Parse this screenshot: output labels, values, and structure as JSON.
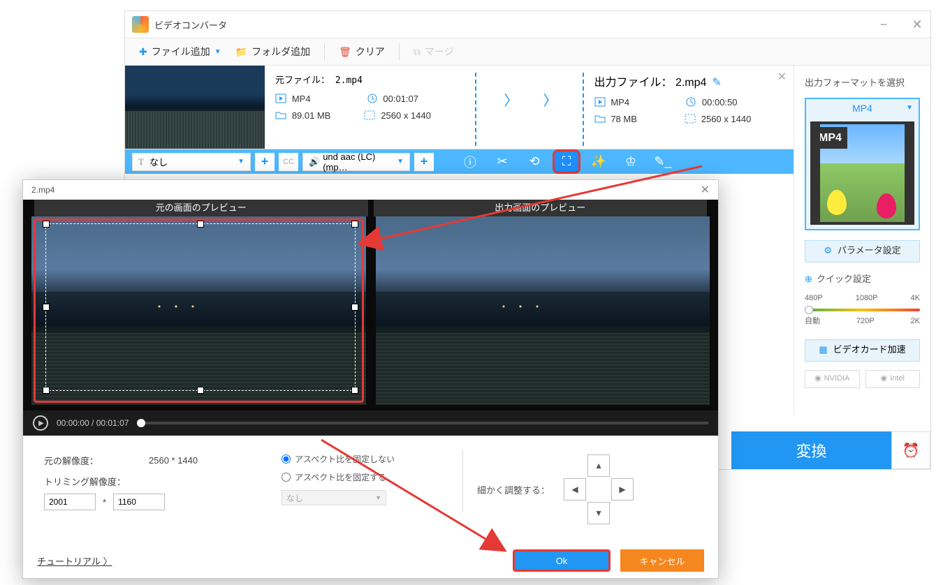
{
  "app": {
    "title": "ビデオコンバータ"
  },
  "toolbar": {
    "add_file": "ファイル追加",
    "add_folder": "フォルダ追加",
    "clear": "クリア",
    "merge": "マージ"
  },
  "file": {
    "source_label": "元ファイル： 2.mp4",
    "output_label": "出力ファイル： 2.mp4",
    "src": {
      "format": "MP4",
      "duration": "00:01:07",
      "size": "89.01 MB",
      "resolution": "2560 x 1440"
    },
    "out": {
      "format": "MP4",
      "duration": "00:00:50",
      "size": "78 MB",
      "resolution": "2560 x 1440"
    }
  },
  "strip": {
    "subtitle_select": "なし",
    "subtitle_prefix": "T",
    "audio_select": "und aac (LC) (mp…"
  },
  "sidebar": {
    "title": "出力フォーマットを選択",
    "format": "MP4",
    "param_btn": "パラメータ設定",
    "quick_title": "クイック設定",
    "labels_top": [
      "480P",
      "1080P",
      "4K"
    ],
    "labels_bot": [
      "自動",
      "720P",
      "2K"
    ],
    "accel_btn": "ビデオカード加速",
    "vendor1": "NVIDIA",
    "vendor2": "Intel"
  },
  "footer": {
    "convert": "変換"
  },
  "crop": {
    "filename": "2.mp4",
    "src_preview": "元の画面のプレビュー",
    "out_preview": "出力画面のプレビュー",
    "time_current": "00:00:00",
    "time_total": "00:01:07",
    "orig_res_label": "元の解像度：",
    "orig_res_value": "2560 * 1440",
    "trim_res_label": "トリミング解像度：",
    "w": "2001",
    "h": "1160",
    "sep": "*",
    "aspect_free": "アスペクト比を固定しない",
    "aspect_lock": "アスペクト比を固定する",
    "aspect_sel": "なし",
    "fine_label": "細かく調整する：",
    "tutorial": "チュートリアル 〉",
    "ok": "Ok",
    "cancel": "キャンセル"
  }
}
